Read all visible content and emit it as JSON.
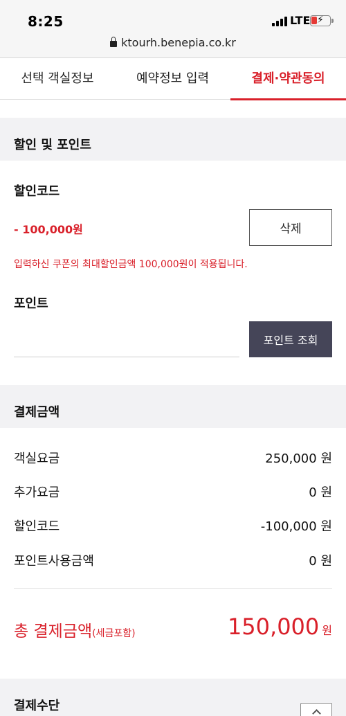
{
  "status_bar": {
    "time": "8:25",
    "network": "LTE",
    "url": "ktourh.benepia.co.kr"
  },
  "steps": [
    {
      "label": "선택 객실정보"
    },
    {
      "label": "예약정보 입력"
    },
    {
      "label": "결제·약관동의"
    }
  ],
  "discount_section": {
    "title": "할인 및 포인트",
    "coupon_label": "할인코드",
    "coupon_amount": "- 100,000원",
    "delete_button": "삭제",
    "notice": "입력하신 쿠폰의 최대할인금액 100,000원이 적용됩니다.",
    "point_label": "포인트",
    "point_input_value": "",
    "point_button": "포인트 조회"
  },
  "payment_section": {
    "title": "결제금액",
    "rows": [
      {
        "label": "객실요금",
        "value": "250,000 원"
      },
      {
        "label": "추가요금",
        "value": "0 원"
      },
      {
        "label": "할인코드",
        "value": "-100,000 원"
      },
      {
        "label": "포인트사용금액",
        "value": "0 원"
      }
    ],
    "total_label": "총 결제금액",
    "total_note": "(세금포함)",
    "total_value": "150,000",
    "total_unit": "원"
  },
  "method_section": {
    "title": "결제수단"
  },
  "colors": {
    "accent": "#d9202a",
    "dark_button": "#454558",
    "section_bg": "#f2f2f4"
  },
  "icons": {
    "lock": "lock-icon",
    "scroll_top": "arrow-up-icon"
  }
}
